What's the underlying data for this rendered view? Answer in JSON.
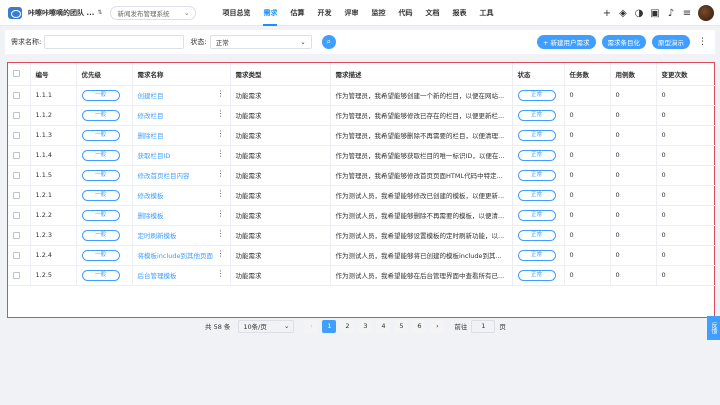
{
  "header": {
    "team": "咔嚓咔嚓嘀的团队 ...",
    "project": "新闻发布管理系统",
    "nav": [
      "项目总览",
      "需求",
      "估算",
      "开发",
      "评审",
      "监控",
      "代码",
      "文档",
      "报表",
      "工具"
    ],
    "active_nav": "需求",
    "icons": [
      "plus-icon",
      "layers-icon",
      "half-circle-icon",
      "briefcase-icon",
      "bell-icon",
      "sliders-icon"
    ]
  },
  "filter": {
    "name_label": "需求名称:",
    "name_placeholder": "",
    "status_label": "状态:",
    "status_value": "正常",
    "buttons": [
      "+ 新建用户需求",
      "需求条目化",
      "原型演示"
    ]
  },
  "table": {
    "columns": [
      "",
      "编号",
      "优先级",
      "需求名称",
      "需求类型",
      "需求描述",
      "状态",
      "任务数",
      "用例数",
      "变更次数"
    ],
    "rows": [
      {
        "id": "1.1.1",
        "priority": "一般",
        "name": "创建栏目",
        "type": "功能需求",
        "desc": "作为管理员，我希望能够创建一个新的栏目，以便在网站...",
        "status": "正常",
        "tasks": "0",
        "cases": "0",
        "changes": "0"
      },
      {
        "id": "1.1.2",
        "priority": "一般",
        "name": "修改栏目",
        "type": "功能需求",
        "desc": "作为管理员，我希望能够修改已存在的栏目，以便更新栏...",
        "status": "正常",
        "tasks": "0",
        "cases": "0",
        "changes": "0"
      },
      {
        "id": "1.1.3",
        "priority": "一般",
        "name": "删除栏目",
        "type": "功能需求",
        "desc": "作为管理员，我希望能够删除不再需要的栏目，以便清理...",
        "status": "正常",
        "tasks": "0",
        "cases": "0",
        "changes": "0"
      },
      {
        "id": "1.1.4",
        "priority": "一般",
        "name": "获取栏目ID",
        "type": "功能需求",
        "desc": "作为管理员，我希望能够获取栏目的唯一标识ID，以便在...",
        "status": "正常",
        "tasks": "0",
        "cases": "0",
        "changes": "0"
      },
      {
        "id": "1.1.5",
        "priority": "一般",
        "name": "修改首页栏目内容",
        "type": "功能需求",
        "desc": "作为管理员，我希望能够修改首页页面HTML代码中特定...",
        "status": "正常",
        "tasks": "0",
        "cases": "0",
        "changes": "0"
      },
      {
        "id": "1.2.1",
        "priority": "一般",
        "name": "修改模板",
        "type": "功能需求",
        "desc": "作为测试人员，我希望能够修改已创建的模板，以便更新...",
        "status": "正常",
        "tasks": "0",
        "cases": "0",
        "changes": "0"
      },
      {
        "id": "1.2.2",
        "priority": "一般",
        "name": "删除模板",
        "type": "功能需求",
        "desc": "作为测试人员，我希望能够删除不再需要的模板，以便清...",
        "status": "正常",
        "tasks": "0",
        "cases": "0",
        "changes": "0"
      },
      {
        "id": "1.2.3",
        "priority": "一般",
        "name": "定时刷新模板",
        "type": "功能需求",
        "desc": "作为测试人员，我希望能够设置模板的定时刷新功能，以...",
        "status": "正常",
        "tasks": "0",
        "cases": "0",
        "changes": "0"
      },
      {
        "id": "1.2.4",
        "priority": "一般",
        "name": "将模板include到其他页面",
        "type": "功能需求",
        "desc": "作为测试人员，我希望能够将已创建的模板include到其...",
        "status": "正常",
        "tasks": "0",
        "cases": "0",
        "changes": "0"
      },
      {
        "id": "1.2.5",
        "priority": "一般",
        "name": "后台管理模板",
        "type": "功能需求",
        "desc": "作为测试人员，我希望能够在后台管理界面中查看所有已...",
        "status": "正常",
        "tasks": "0",
        "cases": "0",
        "changes": "0"
      }
    ]
  },
  "pager": {
    "total": "共 58 条",
    "page_size": "10条/页",
    "pages": [
      "1",
      "2",
      "3",
      "4",
      "5",
      "6"
    ],
    "current": "1",
    "goto_label": "前往",
    "goto_value": "1",
    "page_suffix": "页"
  },
  "feedback": "反馈"
}
